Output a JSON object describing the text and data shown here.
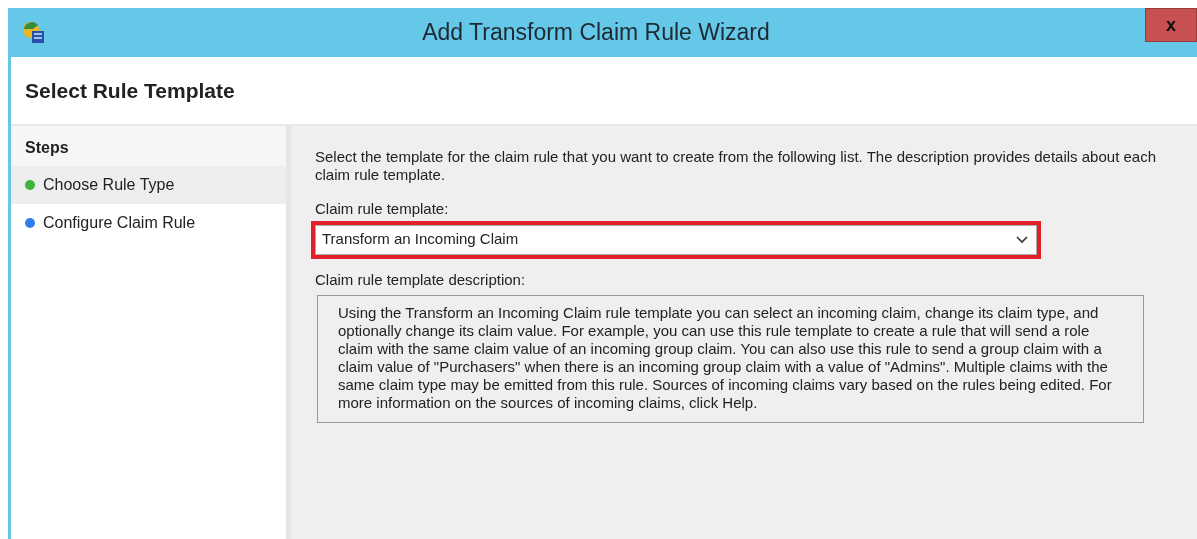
{
  "window": {
    "title": "Add Transform Claim Rule Wizard",
    "close": "x"
  },
  "header": {
    "title": "Select Rule Template"
  },
  "steps": {
    "title": "Steps",
    "items": [
      {
        "label": "Choose Rule Type",
        "selected": true,
        "color": "#3cb43c"
      },
      {
        "label": "Configure Claim Rule",
        "selected": false,
        "color": "#2f7fe8"
      }
    ]
  },
  "content": {
    "intro": "Select the template for the claim rule that you want to create from the following list. The description provides details about each claim rule template.",
    "template_label": "Claim rule template:",
    "template": {
      "value": "Transform an Incoming Claim",
      "highlighted": true
    },
    "description_label": "Claim rule template description:",
    "description": "Using the Transform an Incoming Claim rule template you can select an incoming claim, change its claim type, and optionally change its claim value.  For example, you can use this rule template to create a rule that will send a role claim with the same claim value of an incoming group claim.  You can also use this rule to send a group claim with a claim value of \"Purchasers\" when there is an incoming group claim with a value of \"Admins\".  Multiple claims with the same claim type may be emitted from this rule.  Sources of incoming claims vary based on the rules being edited.  For more information on the sources of incoming claims, click Help."
  }
}
